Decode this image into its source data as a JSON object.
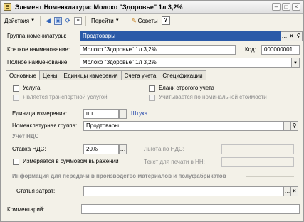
{
  "window": {
    "title": "Элемент Номенклатура: Молоко \"Здоровье\" 1л 3,2%"
  },
  "toolbar": {
    "actions_label": "Действия",
    "goto_label": "Перейти",
    "tips_label": "Советы",
    "help_label": "?"
  },
  "header": {
    "group_label": "Группа номенклатуры:",
    "group_value": "Продтовары",
    "short_name_label": "Краткое наименование:",
    "short_name_value": "Молоко \"Здоровье\" 1л 3,2%",
    "code_label": "Код:",
    "code_value": "000000001",
    "full_name_label": "Полное наименование:",
    "full_name_value": "Молоко \"Здоровье\" 1л 3,2%"
  },
  "tabs": [
    {
      "label": "Основные"
    },
    {
      "label": "Цены"
    },
    {
      "label": "Единицы измерения"
    },
    {
      "label": "Счета учета"
    },
    {
      "label": "Спецификации"
    }
  ],
  "main": {
    "service_label": "Услуга",
    "transport_label": "Является транспортной услугой",
    "strict_blank_label": "Бланк строгого учета",
    "nominal_label": "Учитывается по номинальной стоимости",
    "unit_label": "Единица измерения:",
    "unit_value": "шт",
    "unit_link": "Штука",
    "nom_group_label": "Номенклатурная группа:",
    "nom_group_value": "Продтовары",
    "vat_section": "Учет НДС",
    "vat_rate_label": "Ставка НДС:",
    "vat_rate_value": "20%",
    "vat_benefit_label": "Льгота по НДС:",
    "sum_expr_label": "Измеряется в суммовом выражении",
    "print_text_label": "Текст для печати в НН:",
    "transfer_section": "Информация для передачи в производство материалов и полуфабрикатов",
    "cost_item_label": "Статья затрат:",
    "cost_item_value": ""
  },
  "footer": {
    "comment_label": "Комментарий:",
    "comment_value": ""
  }
}
